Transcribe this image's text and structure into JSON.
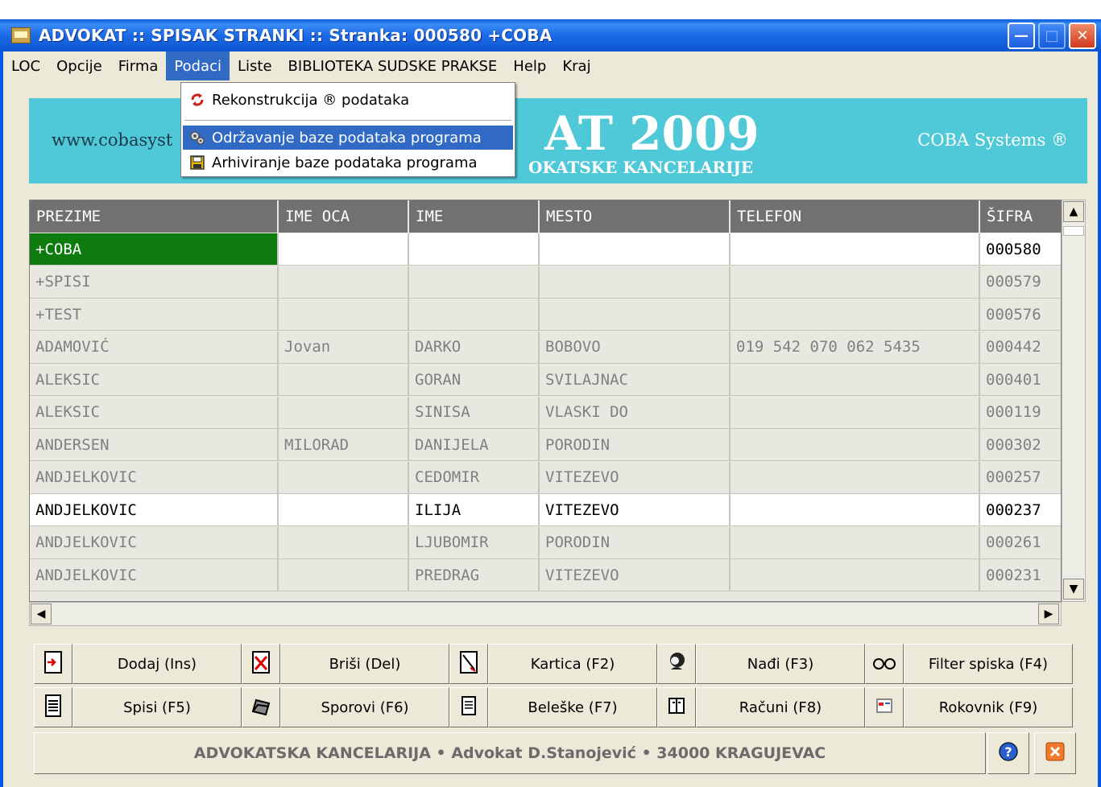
{
  "window": {
    "title": "ADVOKAT :: SPISAK STRANKI :: Stranka: 000580 +COBA"
  },
  "menubar": {
    "items": [
      "LOC",
      "Opcije",
      "Firma",
      "Podaci",
      "Liste",
      "BIBLIOTEKA SUDSKE PRAKSE",
      "Help",
      "Kraj"
    ],
    "active": "Podaci"
  },
  "dropdown": {
    "items": [
      {
        "label": "Rekonstrukcija ® podataka",
        "icon": "refresh-icon"
      },
      {
        "label": "Održavanje baze podataka programa",
        "icon": "gears-icon"
      },
      {
        "label": "Arhiviranje baze podataka programa",
        "icon": "floppy-disk-icon"
      }
    ],
    "highlighted": "Održavanje baze podataka programa"
  },
  "banner": {
    "left": "www.cobasyst",
    "center": "AT 2009",
    "sub": "OKATSKE KANCELARIJE",
    "right": "COBA Systems ®",
    "color": "#4fc8d8"
  },
  "grid": {
    "columns": [
      "PREZIME",
      "IME OCA",
      "IME",
      "MESTO",
      "TELEFON",
      "ŠIFRA"
    ],
    "rows": [
      [
        "+COBA",
        "",
        "",
        "",
        "",
        "000580"
      ],
      [
        "+SPISI",
        "",
        "",
        "",
        "",
        "000579"
      ],
      [
        "+TEST",
        "",
        "",
        "",
        "",
        "000576"
      ],
      [
        "ADAMOVIĆ",
        "Jovan",
        "DARKO",
        "BOBOVO",
        "019 542 070 062 5435",
        "000442"
      ],
      [
        "ALEKSIC",
        "",
        "GORAN",
        "SVILAJNAC",
        "",
        "000401"
      ],
      [
        "ALEKSIC",
        "",
        "SINISA",
        "VLASKI DO",
        "",
        "000119"
      ],
      [
        "ANDERSEN",
        "MILORAD",
        "DANIJELA",
        "PORODIN",
        "",
        "000302"
      ],
      [
        "ANDJELKOVIC",
        "",
        "CEDOMIR",
        "VITEZEVO",
        "",
        "000257"
      ],
      [
        "ANDJELKOVIC",
        "",
        "ILIJA",
        "VITEZEVO",
        "",
        "000237"
      ],
      [
        "ANDJELKOVIC",
        "",
        "LJUBOMIR",
        "PORODIN",
        "",
        "000261"
      ],
      [
        "ANDJELKOVIC",
        "",
        "PREDRAG",
        "VITEZEVO",
        "",
        "000231"
      ]
    ],
    "selected_row": "+COBA",
    "selected_color": "#0e7b0e"
  },
  "toolbar": {
    "row1": [
      {
        "icon": "add-document-icon",
        "label": "Dodaj  (Ins)"
      },
      {
        "icon": "delete-document-icon",
        "label": "Briši  (Del)"
      },
      {
        "icon": "card-icon",
        "label": "Kartica (F2)"
      },
      {
        "icon": "person-search-icon",
        "label": "Nađi (F3)"
      },
      {
        "icon": "glasses-icon",
        "label": "Filter spiska (F4)"
      }
    ],
    "row2": [
      {
        "icon": "files-icon",
        "label": "Spisi  (F5)"
      },
      {
        "icon": "folder-icon",
        "label": "Sporovi  (F6)"
      },
      {
        "icon": "notes-icon",
        "label": "Beleške  (F7)"
      },
      {
        "icon": "invoice-icon",
        "label": "Računi  (F8)"
      },
      {
        "icon": "calendar-icon",
        "label": "Rokovnik  (F9)"
      }
    ]
  },
  "status": {
    "text": "ADVOKATSKA KANCELARIJA • Advokat D.Stanojević • 34000 KRAGUJEVAC"
  }
}
